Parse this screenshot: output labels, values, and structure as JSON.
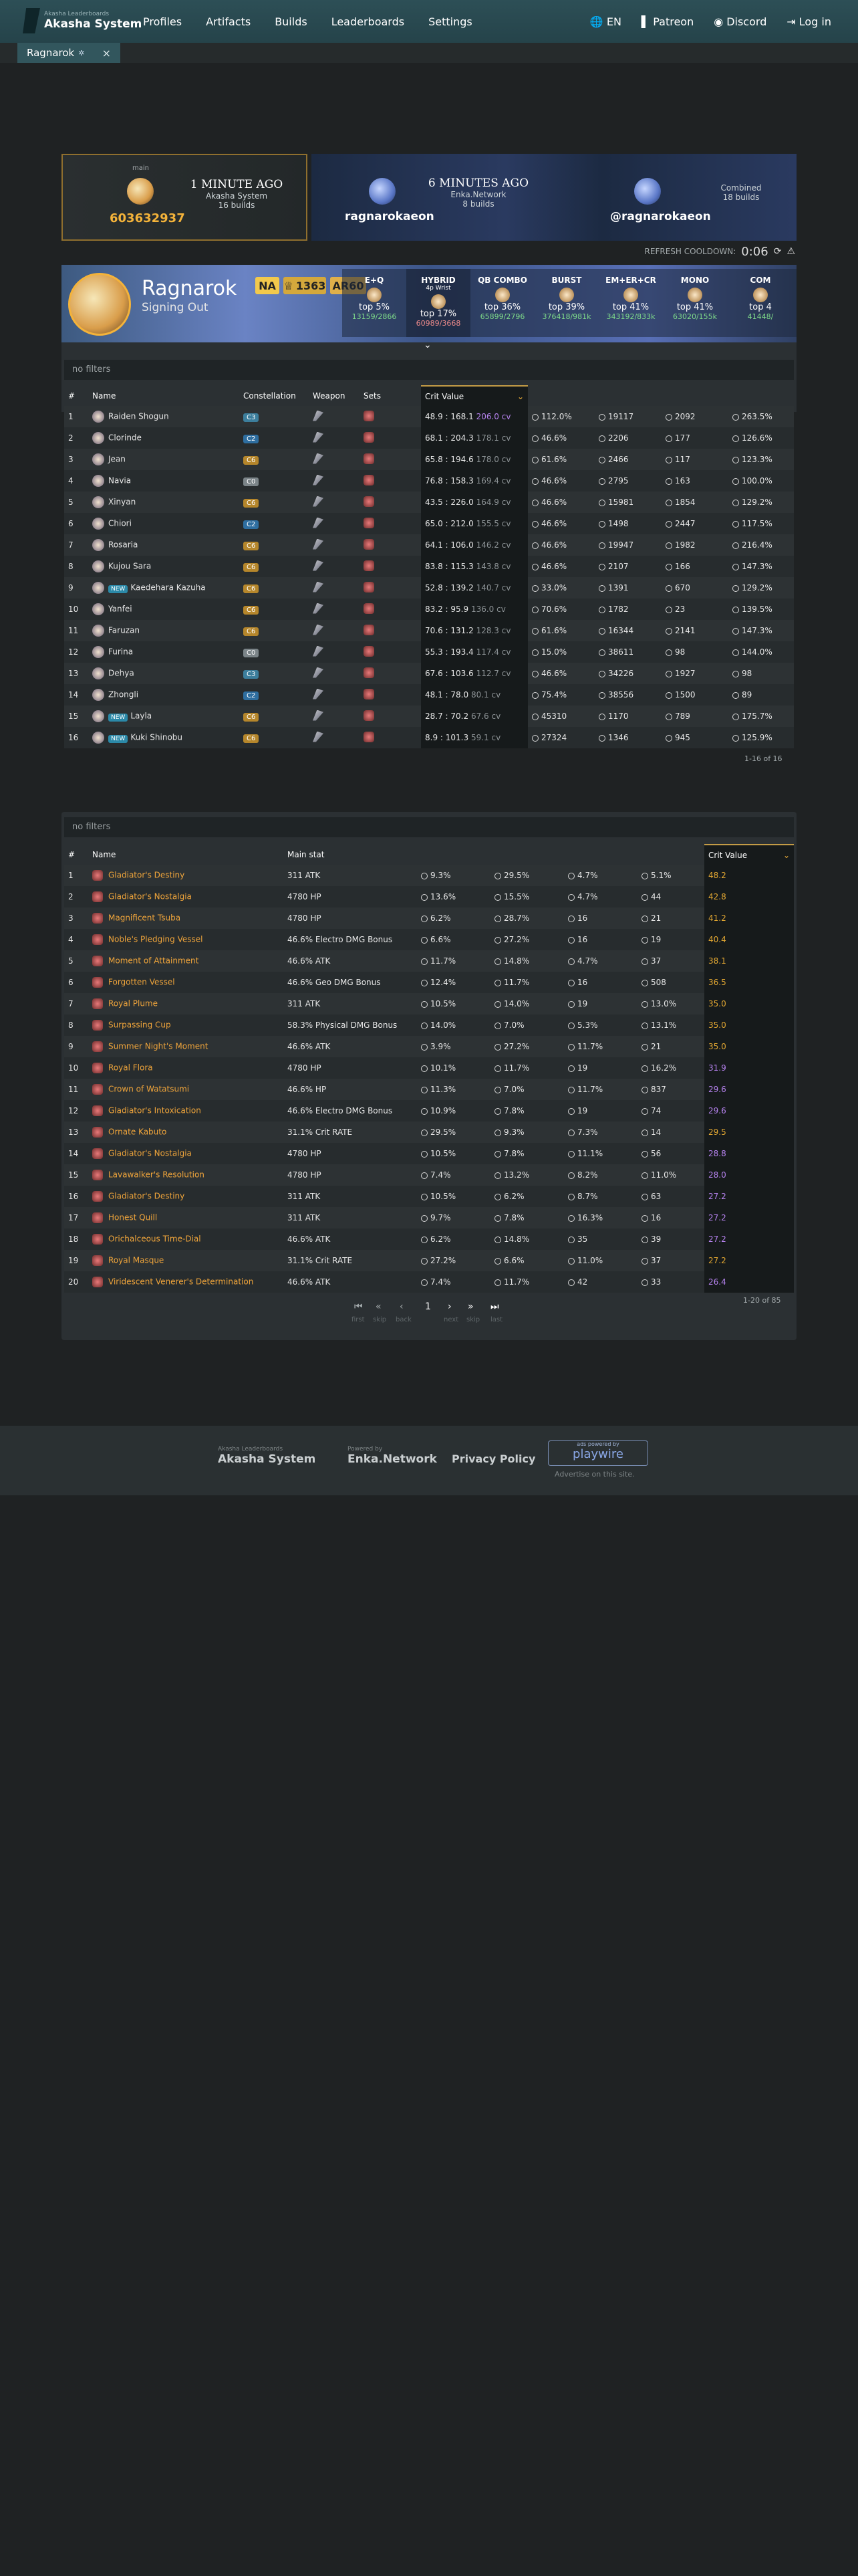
{
  "nav": {
    "logo_sub": "Akasha Leaderboards",
    "logo_name": "Akasha System",
    "links": [
      "Profiles",
      "Artifacts",
      "Builds",
      "Leaderboards",
      "Settings"
    ],
    "lang": "EN",
    "patreon": "Patreon",
    "discord": "Discord",
    "login": "Log in"
  },
  "tab": {
    "label": "Ragnarok",
    "close": "×"
  },
  "cards": {
    "c1": {
      "label": "main",
      "ago": "1 MINUTE AGO",
      "source": "Akasha System",
      "builds": "16 builds",
      "uid": "603632937"
    },
    "c2": {
      "ago": "6 MINUTES AGO",
      "source": "Enka.Network",
      "builds": "8 builds",
      "name": "ragnarokaeon"
    },
    "c3": {
      "label": "Combined",
      "builds": "18 builds",
      "name": "@ragnarokaeon"
    }
  },
  "cooldown": {
    "label": "REFRESH COOLDOWN:",
    "time": "0:06"
  },
  "profile": {
    "name": "Ragnarok",
    "signature": "Signing Out",
    "region": "NA",
    "achievements": "1363",
    "ar": "AR60",
    "stats": [
      {
        "head": "E+Q",
        "sub": "",
        "level": "lv.90",
        "top": "top 5%",
        "val": "13159/2866"
      },
      {
        "head": "HYBRID",
        "sub": "4p Wrist",
        "level": "lv.90",
        "top": "top 17%",
        "val": "60989/3668"
      },
      {
        "head": "QB COMBO",
        "sub": "",
        "level": "lv.90",
        "top": "top 36%",
        "val": "65899/2796"
      },
      {
        "head": "BURST",
        "sub": "",
        "level": "lv.90",
        "top": "top 39%",
        "val": "376418/981k"
      },
      {
        "head": "EM+ER+CR",
        "sub": "",
        "level": "lv.90",
        "top": "top 41%",
        "val": "343192/833k"
      },
      {
        "head": "MONO",
        "sub": "",
        "level": "lv.90",
        "top": "top 41%",
        "val": "63020/155k"
      },
      {
        "head": "COM",
        "sub": "",
        "level": "lv.90",
        "top": "top 4",
        "val": "41448/"
      }
    ],
    "filter_placeholder": "no filters"
  },
  "builds": {
    "headers": [
      "#",
      "Name",
      "Constellation",
      "Weapon",
      "Sets",
      "Crit Value",
      "",
      "",
      "",
      "",
      ""
    ],
    "rows": [
      {
        "n": "1",
        "name": "Raiden Shogun",
        "new": "",
        "c": "C3",
        "cls": "c3",
        "cv": "48.9 : 168.1",
        "cvv": "206.0 cv",
        "purple": "1",
        "s1": "112.0%",
        "s2": "19117",
        "s3": "2092",
        "s4": "263.5%"
      },
      {
        "n": "2",
        "name": "Clorinde",
        "new": "",
        "c": "C2",
        "cls": "c2",
        "cv": "68.1 : 204.3",
        "cvv": "178.1 cv",
        "purple": "0",
        "s1": "46.6%",
        "s2": "2206",
        "s3": "177",
        "s4": "126.6%"
      },
      {
        "n": "3",
        "name": "Jean",
        "new": "",
        "c": "C6",
        "cls": "c6",
        "cv": "65.8 : 194.6",
        "cvv": "178.0 cv",
        "purple": "0",
        "s1": "61.6%",
        "s2": "2466",
        "s3": "117",
        "s4": "123.3%"
      },
      {
        "n": "4",
        "name": "Navia",
        "new": "",
        "c": "C0",
        "cls": "c0",
        "cv": "76.8 : 158.3",
        "cvv": "169.4 cv",
        "purple": "0",
        "s1": "46.6%",
        "s2": "2795",
        "s3": "163",
        "s4": "100.0%"
      },
      {
        "n": "5",
        "name": "Xinyan",
        "new": "",
        "c": "C6",
        "cls": "c6",
        "cv": "43.5 : 226.0",
        "cvv": "164.9 cv",
        "purple": "0",
        "s1": "46.6%",
        "s2": "15981",
        "s3": "1854",
        "s4": "129.2%"
      },
      {
        "n": "6",
        "name": "Chiori",
        "new": "",
        "c": "C2",
        "cls": "c2",
        "cv": "65.0 : 212.0",
        "cvv": "155.5 cv",
        "purple": "0",
        "s1": "46.6%",
        "s2": "1498",
        "s3": "2447",
        "s4": "117.5%"
      },
      {
        "n": "7",
        "name": "Rosaria",
        "new": "",
        "c": "C6",
        "cls": "c6",
        "cv": "64.1 : 106.0",
        "cvv": "146.2 cv",
        "purple": "0",
        "s1": "46.6%",
        "s2": "19947",
        "s3": "1982",
        "s4": "216.4%"
      },
      {
        "n": "8",
        "name": "Kujou Sara",
        "new": "",
        "c": "C6",
        "cls": "c6",
        "cv": "83.8 : 115.3",
        "cvv": "143.8 cv",
        "purple": "0",
        "s1": "46.6%",
        "s2": "2107",
        "s3": "166",
        "s4": "147.3%"
      },
      {
        "n": "9",
        "name": "Kaedehara Kazuha",
        "new": "NEW",
        "c": "C6",
        "cls": "c6",
        "cv": "52.8 : 139.2",
        "cvv": "140.7 cv",
        "purple": "0",
        "s1": "33.0%",
        "s2": "1391",
        "s3": "670",
        "s4": "129.2%"
      },
      {
        "n": "10",
        "name": "Yanfei",
        "new": "",
        "c": "C6",
        "cls": "c6",
        "cv": "83.2 : 95.9",
        "cvv": "136.0 cv",
        "purple": "0",
        "s1": "70.6%",
        "s2": "1782",
        "s3": "23",
        "s4": "139.5%"
      },
      {
        "n": "11",
        "name": "Faruzan",
        "new": "",
        "c": "C6",
        "cls": "c6",
        "cv": "70.6 : 131.2",
        "cvv": "128.3 cv",
        "purple": "0",
        "s1": "61.6%",
        "s2": "16344",
        "s3": "2141",
        "s4": "147.3%"
      },
      {
        "n": "12",
        "name": "Furina",
        "new": "",
        "c": "C0",
        "cls": "c0",
        "cv": "55.3 : 193.4",
        "cvv": "117.4 cv",
        "purple": "0",
        "s1": "15.0%",
        "s2": "38611",
        "s3": "98",
        "s4": "144.0%"
      },
      {
        "n": "13",
        "name": "Dehya",
        "new": "",
        "c": "C3",
        "cls": "c3",
        "cv": "67.6 : 103.6",
        "cvv": "112.7 cv",
        "purple": "0",
        "s1": "46.6%",
        "s2": "34226",
        "s3": "1927",
        "s4": "98"
      },
      {
        "n": "14",
        "name": "Zhongli",
        "new": "",
        "c": "C2",
        "cls": "c2",
        "cv": "48.1 : 78.0",
        "cvv": "80.1 cv",
        "purple": "0",
        "s1": "75.4%",
        "s2": "38556",
        "s3": "1500",
        "s4": "89"
      },
      {
        "n": "15",
        "name": "Layla",
        "new": "NEW",
        "c": "C6",
        "cls": "c6",
        "cv": "28.7 : 70.2",
        "cvv": "67.6 cv",
        "purple": "0",
        "s1": "45310",
        "s2": "1170",
        "s3": "789",
        "s4": "175.7%"
      },
      {
        "n": "16",
        "name": "Kuki Shinobu",
        "new": "NEW",
        "c": "C6",
        "cls": "c6",
        "cv": "8.9 : 101.3",
        "cvv": "59.1 cv",
        "purple": "0",
        "s1": "27324",
        "s2": "1346",
        "s3": "945",
        "s4": "125.9%"
      }
    ],
    "count": "1-16 of 16"
  },
  "artifacts": {
    "filter_placeholder": "no filters",
    "headers": [
      "#",
      "Name",
      "Main stat",
      "",
      "",
      "",
      "",
      "Crit Value"
    ],
    "rows": [
      {
        "n": "1",
        "name": "Gladiator's Destiny",
        "main": "311 ATK",
        "a": "9.3%",
        "b": "29.5%",
        "c": "4.7%",
        "d": "5.1%",
        "cv": "48.2",
        "col": "gold"
      },
      {
        "n": "2",
        "name": "Gladiator's Nostalgia",
        "main": "4780 HP",
        "a": "13.6%",
        "b": "15.5%",
        "c": "4.7%",
        "d": "44",
        "cv": "42.8",
        "col": "gold"
      },
      {
        "n": "3",
        "name": "Magnificent Tsuba",
        "main": "4780 HP",
        "a": "6.2%",
        "b": "28.7%",
        "c": "16",
        "d": "21",
        "cv": "41.2",
        "col": "gold"
      },
      {
        "n": "4",
        "name": "Noble's Pledging Vessel",
        "main": "46.6% Electro DMG Bonus",
        "a": "6.6%",
        "b": "27.2%",
        "c": "16",
        "d": "19",
        "cv": "40.4",
        "col": "gold"
      },
      {
        "n": "5",
        "name": "Moment of Attainment",
        "main": "46.6% ATK",
        "a": "11.7%",
        "b": "14.8%",
        "c": "4.7%",
        "d": "37",
        "cv": "38.1",
        "col": "gold"
      },
      {
        "n": "6",
        "name": "Forgotten Vessel",
        "main": "46.6% Geo DMG Bonus",
        "a": "12.4%",
        "b": "11.7%",
        "c": "16",
        "d": "508",
        "cv": "36.5",
        "col": "gold"
      },
      {
        "n": "7",
        "name": "Royal Plume",
        "main": "311 ATK",
        "a": "10.5%",
        "b": "14.0%",
        "c": "19",
        "d": "13.0%",
        "cv": "35.0",
        "col": "gold"
      },
      {
        "n": "8",
        "name": "Surpassing Cup",
        "main": "58.3% Physical DMG Bonus",
        "a": "14.0%",
        "b": "7.0%",
        "c": "5.3%",
        "d": "13.1%",
        "cv": "35.0",
        "col": "gold"
      },
      {
        "n": "9",
        "name": "Summer Night's Moment",
        "main": "46.6% ATK",
        "a": "3.9%",
        "b": "27.2%",
        "c": "11.7%",
        "d": "21",
        "cv": "35.0",
        "col": "gold"
      },
      {
        "n": "10",
        "name": "Royal Flora",
        "main": "4780 HP",
        "a": "10.1%",
        "b": "11.7%",
        "c": "19",
        "d": "16.2%",
        "cv": "31.9",
        "col": "purple"
      },
      {
        "n": "11",
        "name": "Crown of Watatsumi",
        "main": "46.6% HP",
        "a": "11.3%",
        "b": "7.0%",
        "c": "11.7%",
        "d": "837",
        "cv": "29.6",
        "col": "purple"
      },
      {
        "n": "12",
        "name": "Gladiator's Intoxication",
        "main": "46.6% Electro DMG Bonus",
        "a": "10.9%",
        "b": "7.8%",
        "c": "19",
        "d": "74",
        "cv": "29.6",
        "col": "purple"
      },
      {
        "n": "13",
        "name": "Ornate Kabuto",
        "main": "31.1% Crit RATE",
        "a": "29.5%",
        "b": "9.3%",
        "c": "7.3%",
        "d": "14",
        "cv": "29.5",
        "col": "gold"
      },
      {
        "n": "14",
        "name": "Gladiator's Nostalgia",
        "main": "4780 HP",
        "a": "10.5%",
        "b": "7.8%",
        "c": "11.1%",
        "d": "56",
        "cv": "28.8",
        "col": "purple"
      },
      {
        "n": "15",
        "name": "Lavawalker's Resolution",
        "main": "4780 HP",
        "a": "7.4%",
        "b": "13.2%",
        "c": "8.2%",
        "d": "11.0%",
        "cv": "28.0",
        "col": "purple"
      },
      {
        "n": "16",
        "name": "Gladiator's Destiny",
        "main": "311 ATK",
        "a": "10.5%",
        "b": "6.2%",
        "c": "8.7%",
        "d": "63",
        "cv": "27.2",
        "col": "purple"
      },
      {
        "n": "17",
        "name": "Honest Quill",
        "main": "311 ATK",
        "a": "9.7%",
        "b": "7.8%",
        "c": "16.3%",
        "d": "16",
        "cv": "27.2",
        "col": "purple"
      },
      {
        "n": "18",
        "name": "Orichalceous Time-Dial",
        "main": "46.6% ATK",
        "a": "6.2%",
        "b": "14.8%",
        "c": "35",
        "d": "39",
        "cv": "27.2",
        "col": "purple"
      },
      {
        "n": "19",
        "name": "Royal Masque",
        "main": "31.1% Crit RATE",
        "a": "27.2%",
        "b": "6.6%",
        "c": "11.0%",
        "d": "37",
        "cv": "27.2",
        "col": "gold"
      },
      {
        "n": "20",
        "name": "Viridescent Venerer's Determination",
        "main": "46.6% ATK",
        "a": "7.4%",
        "b": "11.7%",
        "c": "42",
        "d": "33",
        "cv": "26.4",
        "col": "purple"
      }
    ],
    "count": "1-20 of 85",
    "pager": {
      "first": "first",
      "skip1": "skip",
      "back": "back",
      "page": "1",
      "next": "next",
      "skip2": "skip",
      "last": "last"
    }
  },
  "footer": {
    "akasha_sub": "Akasha Leaderboards",
    "akasha": "Akasha System",
    "enka_sub": "Powered by",
    "enka": "Enka.Network",
    "privacy": "Privacy Policy",
    "ads_sub": "ads powered by",
    "ads": "playwire",
    "advertise": "Advertise on this site."
  }
}
